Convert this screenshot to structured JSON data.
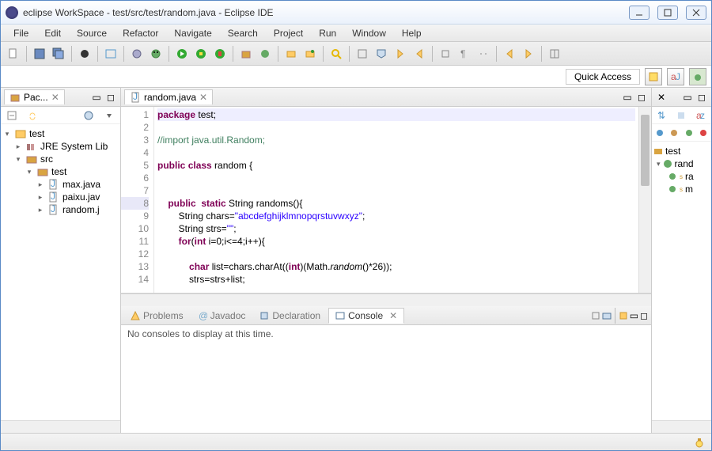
{
  "window": {
    "title": "eclipse WorkSpace - test/src/test/random.java - Eclipse IDE"
  },
  "menu": {
    "items": [
      "File",
      "Edit",
      "Source",
      "Refactor",
      "Navigate",
      "Search",
      "Project",
      "Run",
      "Window",
      "Help"
    ]
  },
  "quickaccess": {
    "label": "Quick Access"
  },
  "package_explorer": {
    "tab_label": "Pac...",
    "tree": {
      "project": "test",
      "jre": "JRE System Lib",
      "src": "src",
      "pkg": "test",
      "files": [
        "max.java",
        "paixu.jav",
        "random.j"
      ]
    }
  },
  "editor": {
    "tab_label": "random.java",
    "lines": [
      "1",
      "2",
      "3",
      "4",
      "5",
      "6",
      "7",
      "8",
      "9",
      "10",
      "11",
      "12",
      "13",
      "14"
    ],
    "code": {
      "l1_kw": "package",
      "l1_rest": " test;",
      "l3_cm": "//import java.util.Random;",
      "l5_kw1": "public",
      "l5_kw2": "class",
      "l5_rest": " random {",
      "l8_kw1": "public",
      "l8_kw2": "static",
      "l8_rest": " String randoms(){",
      "l9_a": "        String chars=",
      "l9_str": "\"abcdefghijklmnopqrstuvwxyz\"",
      "l9_b": ";",
      "l10_a": "        String strs=",
      "l10_str": "\"\"",
      "l10_b": ";",
      "l11_kw": "for",
      "l11_a": "(",
      "l11_kw2": "int",
      "l11_b": " i=0;i<=4;i++){",
      "l13_kw": "char",
      "l13_a": " list=chars.charAt((",
      "l13_kw2": "int",
      "l13_b": ")(Math.",
      "l13_mth": "random",
      "l13_c": "()*26));",
      "l14": "            strs=strs+list;"
    }
  },
  "bottom_tabs": {
    "problems": "Problems",
    "javadoc": "Javadoc",
    "declaration": "Declaration",
    "console": "Console"
  },
  "console": {
    "message": "No consoles to display at this time."
  },
  "outline": {
    "items": {
      "pkg": "test",
      "cls": "rand",
      "m1": "ra",
      "m2": "m"
    }
  }
}
